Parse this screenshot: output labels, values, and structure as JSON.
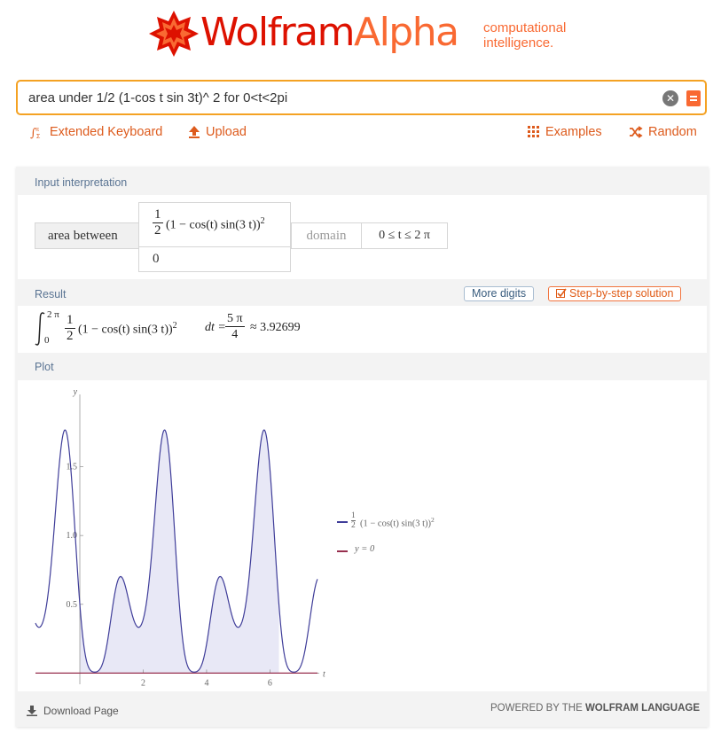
{
  "logo": {
    "brand_part1": "Wolfram",
    "brand_part2": "Alpha",
    "tagline_line1": "computational",
    "tagline_line2": "intelligence."
  },
  "search": {
    "value": "area under 1/2 (1-cos t sin 3t)^ 2 for 0<t<2pi",
    "clear_icon": "close-icon",
    "go_icon": "equals-icon"
  },
  "toolbar": {
    "extended_keyboard": "Extended Keyboard",
    "upload": "Upload",
    "examples": "Examples",
    "random": "Random"
  },
  "input_interpretation": {
    "title": "Input interpretation",
    "label": "area between",
    "upper_num": "1",
    "upper_den": "2",
    "upper_expr": "(1 − cos(t) sin(3 t))",
    "upper_exp": "2",
    "lower": "0",
    "domain_label": "domain",
    "domain_value": "0 ≤ t ≤ 2 π"
  },
  "result": {
    "title": "Result",
    "more_digits": "More digits",
    "step_by_step": "Step-by-step solution",
    "int_upper": "2 π",
    "int_lower": "0",
    "half_num": "1",
    "half_den": "2",
    "integrand": "(1 − cos(t) sin(3 t))",
    "exp": "2",
    "dt": "dt =",
    "val_num": "5 π",
    "val_den": "4",
    "approx": "≈ 3.92699"
  },
  "plot": {
    "title": "Plot",
    "legend": [
      {
        "num": "1",
        "den": "2",
        "label": "(1 − cos(t) sin(3 t))",
        "exp": "2",
        "color": "#3f3d99"
      },
      {
        "label": "y = 0",
        "color": "#972f4e"
      }
    ]
  },
  "chart_data": {
    "type": "line",
    "xlabel": "t",
    "ylabel": "y",
    "xlim": [
      -1.4,
      7.5
    ],
    "ylim": [
      -0.03,
      2.0
    ],
    "x_ticks": [
      2,
      4,
      6
    ],
    "y_ticks": [
      0.5,
      1.0,
      1.5
    ],
    "x_tick_labels": [
      "2",
      "4",
      "6"
    ],
    "y_tick_labels": [
      "0.5",
      "1.0",
      "1.5"
    ],
    "series": [
      {
        "name": "1/2 (1 − cos(t) sin(3 t))^2",
        "function": "0.5*(1-cos(t)*sin(3t))^2",
        "x_range": [
          -1.4,
          7.5
        ],
        "color": "#3f3d99"
      },
      {
        "name": "y = 0",
        "function": "0",
        "x_range": [
          -1.4,
          7.5
        ],
        "color": "#972f4e"
      }
    ],
    "shaded_region": {
      "x_range": [
        0,
        6.283
      ],
      "between": [
        "1/2 (1 − cos(t) sin(3 t))^2",
        "y = 0"
      ],
      "color": "#e8e8f6"
    },
    "grid": false
  },
  "footer": {
    "download": "Download Page",
    "powered_prefix": "POWERED BY THE ",
    "powered_brand": "WOLFRAM LANGUAGE"
  }
}
